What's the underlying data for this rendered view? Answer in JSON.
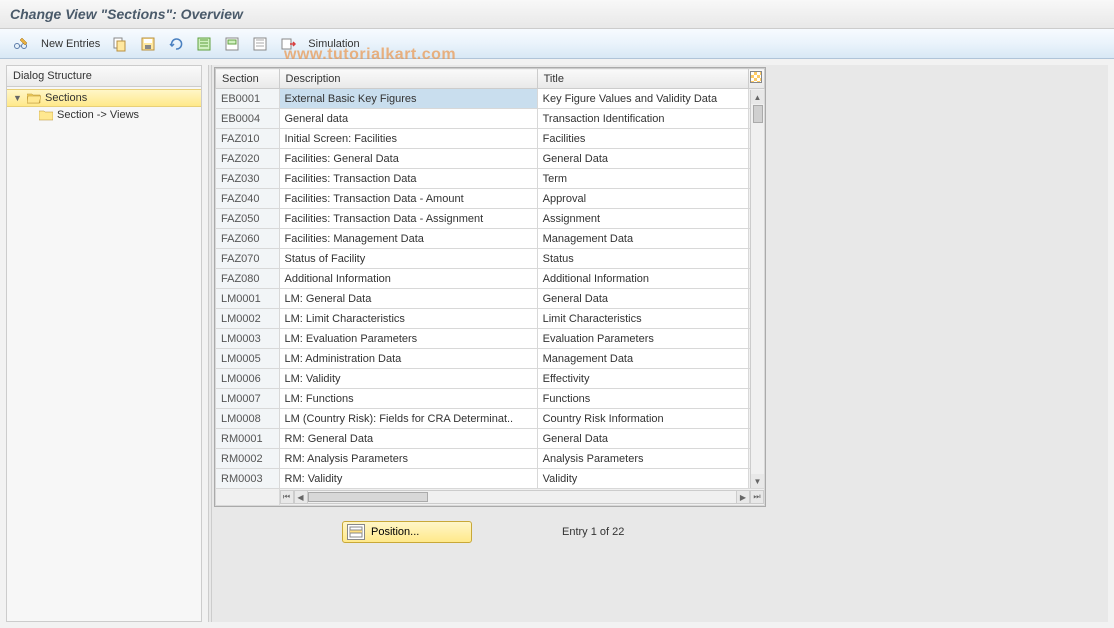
{
  "header": {
    "title": "Change View \"Sections\": Overview"
  },
  "toolbar": {
    "new_entries": "New Entries",
    "simulation": "Simulation"
  },
  "watermark": "www.tutorialkart.com",
  "sidebar": {
    "header": "Dialog Structure",
    "items": [
      {
        "label": "Sections",
        "selected": true,
        "expanded": true
      },
      {
        "label": "Section -> Views",
        "selected": false,
        "child": true
      }
    ]
  },
  "table": {
    "columns": [
      "Section",
      "Description",
      "Title"
    ],
    "rows": [
      {
        "section": "EB0001",
        "description": "External Basic Key Figures",
        "title": "Key Figure Values and Validity Data",
        "selected": true
      },
      {
        "section": "EB0004",
        "description": "General data",
        "title": "Transaction Identification"
      },
      {
        "section": "FAZ010",
        "description": "Initial Screen: Facilities",
        "title": "Facilities"
      },
      {
        "section": "FAZ020",
        "description": "Facilities: General Data",
        "title": "General Data"
      },
      {
        "section": "FAZ030",
        "description": "Facilities: Transaction Data",
        "title": "Term"
      },
      {
        "section": "FAZ040",
        "description": "Facilities: Transaction Data - Amount",
        "title": "Approval"
      },
      {
        "section": "FAZ050",
        "description": "Facilities: Transaction Data - Assignment",
        "title": "Assignment"
      },
      {
        "section": "FAZ060",
        "description": "Facilities: Management Data",
        "title": "Management Data"
      },
      {
        "section": "FAZ070",
        "description": "Status of Facility",
        "title": "Status"
      },
      {
        "section": "FAZ080",
        "description": "Additional Information",
        "title": "Additional Information"
      },
      {
        "section": "LM0001",
        "description": "LM: General Data",
        "title": "General Data"
      },
      {
        "section": "LM0002",
        "description": "LM: Limit Characteristics",
        "title": "Limit Characteristics"
      },
      {
        "section": "LM0003",
        "description": "LM: Evaluation Parameters",
        "title": "Evaluation Parameters"
      },
      {
        "section": "LM0005",
        "description": "LM: Administration Data",
        "title": "Management Data"
      },
      {
        "section": "LM0006",
        "description": "LM: Validity",
        "title": "Effectivity"
      },
      {
        "section": "LM0007",
        "description": "LM: Functions",
        "title": "Functions"
      },
      {
        "section": "LM0008",
        "description": "LM (Country Risk): Fields for CRA Determinat..",
        "title": "Country Risk Information"
      },
      {
        "section": "RM0001",
        "description": "RM: General Data",
        "title": "General Data"
      },
      {
        "section": "RM0002",
        "description": "RM: Analysis Parameters",
        "title": "Analysis Parameters"
      },
      {
        "section": "RM0003",
        "description": "RM: Validity",
        "title": "Validity"
      }
    ]
  },
  "footer": {
    "position_label": "Position...",
    "entry_text": "Entry 1 of 22"
  }
}
